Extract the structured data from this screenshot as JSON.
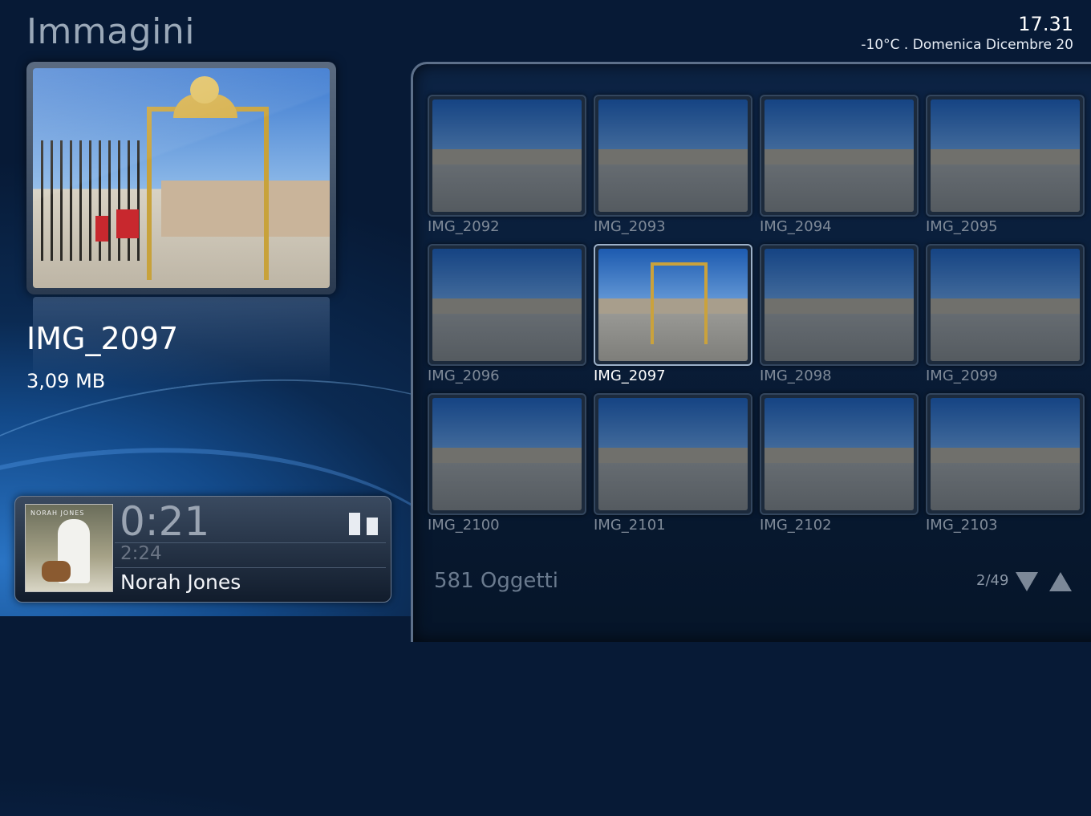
{
  "header": {
    "title": "Immagini",
    "time": "17.31",
    "weather_date": "-10°C  .  Domenica Dicembre 20"
  },
  "preview": {
    "name": "IMG_2097",
    "size": "3,09 MB"
  },
  "now_playing": {
    "elapsed": "0:21",
    "total": "2:24",
    "artist": "Norah Jones",
    "album_art_text": "NORAH JONES"
  },
  "grid": {
    "items": [
      {
        "label": "IMG_2092"
      },
      {
        "label": "IMG_2093"
      },
      {
        "label": "IMG_2094"
      },
      {
        "label": "IMG_2095"
      },
      {
        "label": "IMG_2096"
      },
      {
        "label": "IMG_2097",
        "selected": true
      },
      {
        "label": "IMG_2098"
      },
      {
        "label": "IMG_2099"
      },
      {
        "label": "IMG_2100"
      },
      {
        "label": "IMG_2101"
      },
      {
        "label": "IMG_2102"
      },
      {
        "label": "IMG_2103"
      }
    ]
  },
  "footer": {
    "count": "581 Oggetti",
    "page": "2/49"
  }
}
